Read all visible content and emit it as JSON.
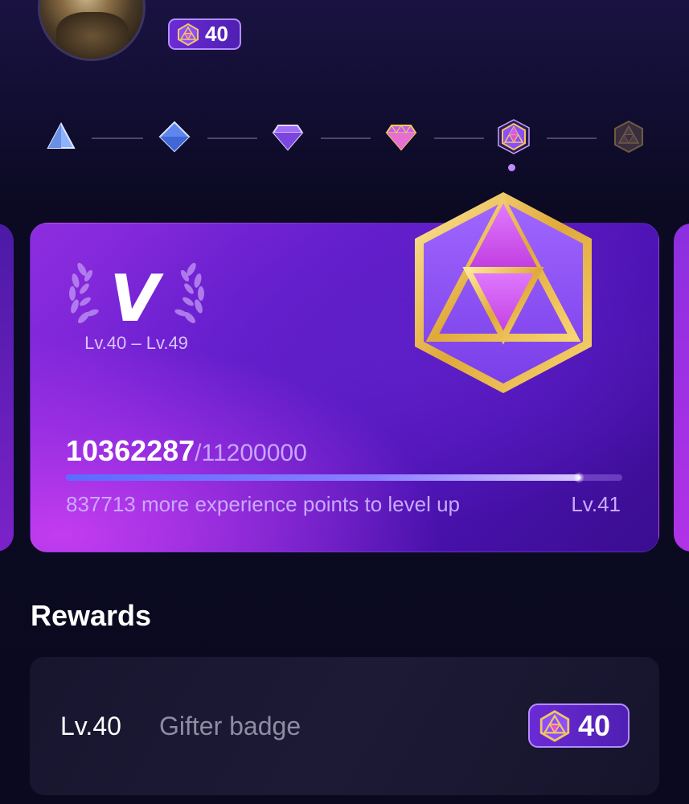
{
  "header": {
    "level_badge": "40"
  },
  "tiers": [
    "tier-1",
    "tier-2",
    "tier-3",
    "tier-4",
    "tier-5",
    "tier-6"
  ],
  "card": {
    "rank_letter": "V",
    "level_range": "Lv.40 – Lv.49",
    "exp_current": "10362287",
    "exp_total": "/11200000",
    "progress_fraction": 0.925,
    "exp_note": "837713 more experience points to level up",
    "next_level": "Lv.41"
  },
  "rewards": {
    "title": "Rewards",
    "items": [
      {
        "level": "Lv.40",
        "name": "Gifter badge",
        "badge_level": "40"
      }
    ]
  }
}
